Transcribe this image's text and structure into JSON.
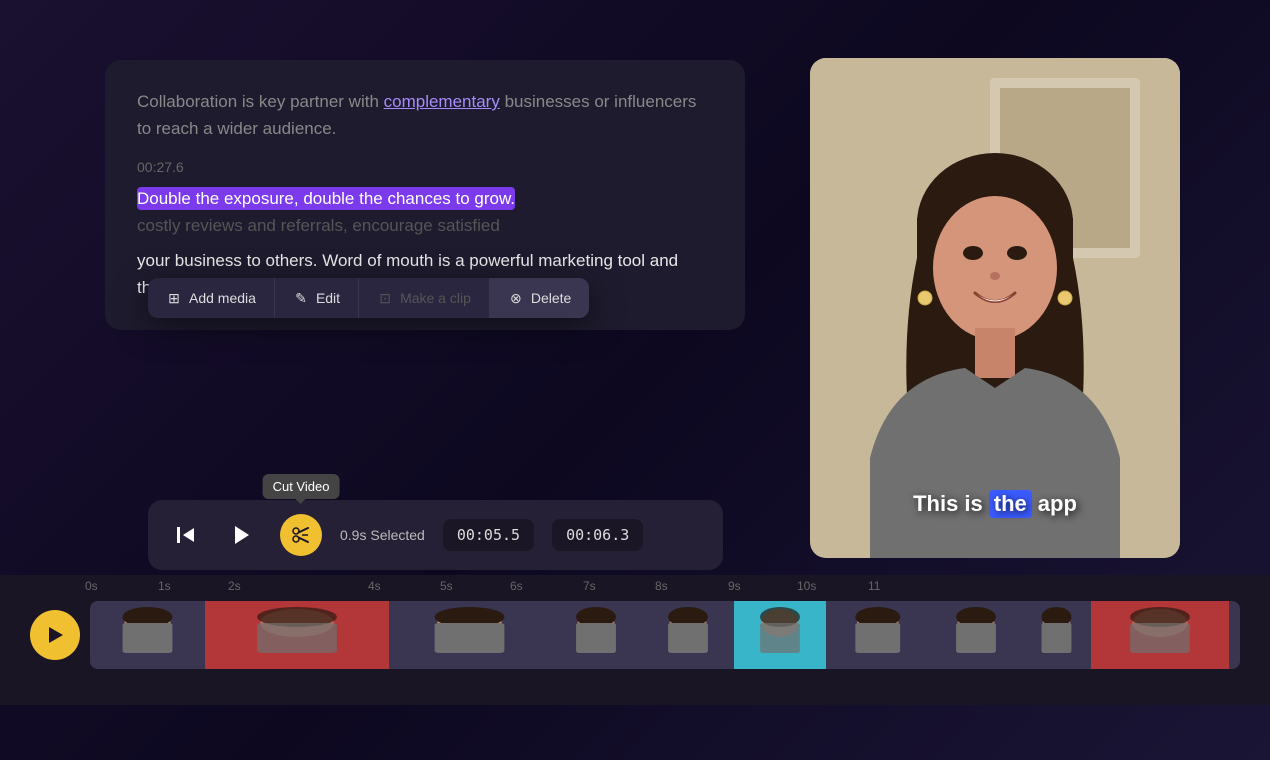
{
  "transcript": {
    "text1": "Collaboration is key partner with ",
    "link_text": "complementary",
    "text2": " businesses or influencers to reach a wider audience.",
    "timestamp": "00:27.6",
    "highlight_text": "Double the exposure, double the chances to grow.",
    "faded_text": "costly reviews and referrals, encourage satisfied",
    "text3": "your business to others. Word of mouth is a powerful marketing tool and there you have it. Small business"
  },
  "context_menu": {
    "add_media": "Add media",
    "edit": "Edit",
    "make_clip": "Make a clip",
    "delete": "Delete"
  },
  "video": {
    "subtitle_before": "This is ",
    "subtitle_highlight": "the",
    "subtitle_after": " app"
  },
  "tooltip": {
    "cut_video": "Cut Video"
  },
  "controls": {
    "selected_label": "0.9s Selected",
    "time_start": "00:05.5",
    "time_end": "00:06.3"
  },
  "timeline": {
    "marks": [
      "0s",
      "1s",
      "2s",
      "4s",
      "5s",
      "6s",
      "7s",
      "8s",
      "9s",
      "10s",
      "11"
    ]
  }
}
